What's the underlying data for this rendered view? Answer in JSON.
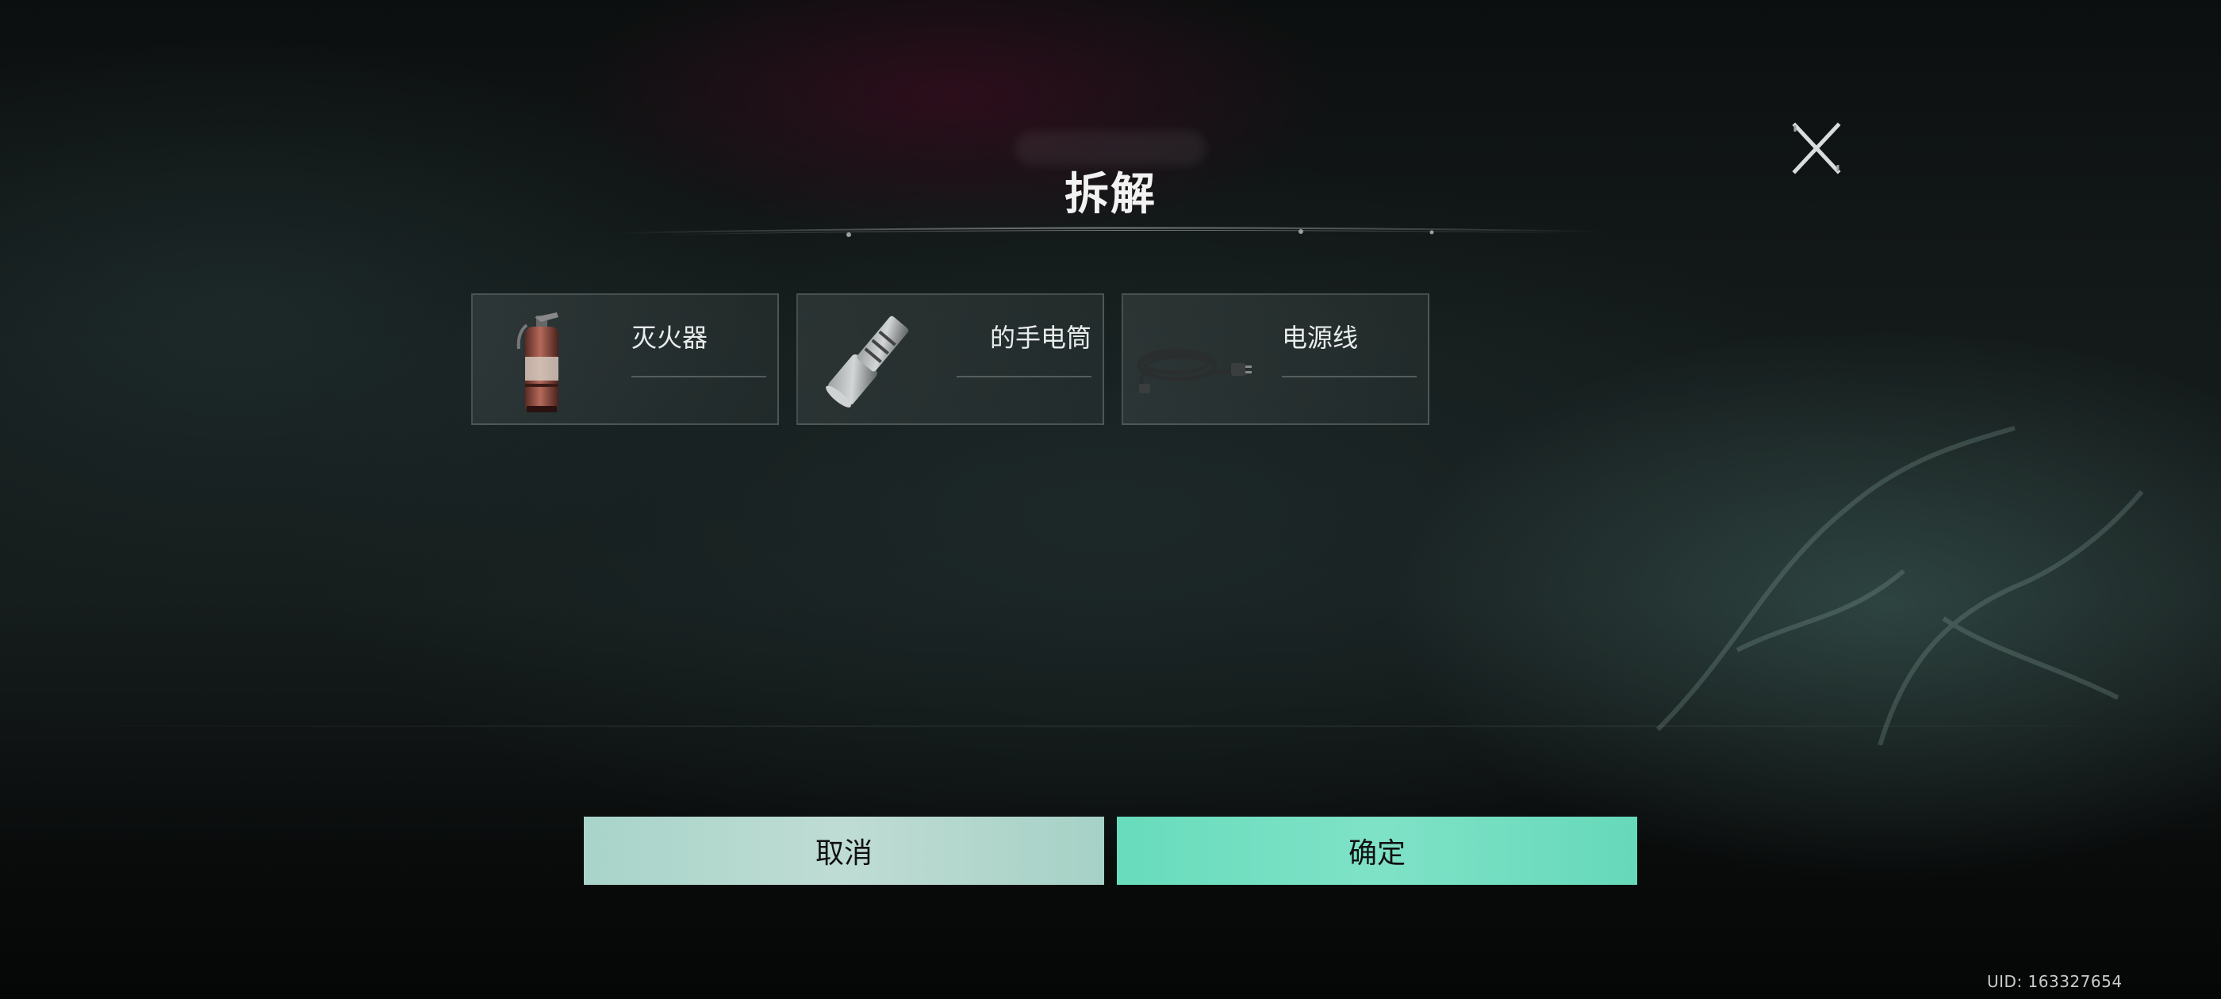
{
  "dialog": {
    "title": "拆解",
    "close_icon": "close-x-icon"
  },
  "items": [
    {
      "name": "灭火器",
      "icon": "fire-extinguisher-icon"
    },
    {
      "name": "的手电筒",
      "icon": "flashlight-icon"
    },
    {
      "name": "电源线",
      "icon": "power-cord-icon"
    }
  ],
  "buttons": {
    "cancel_label": "取消",
    "confirm_label": "确定"
  },
  "footer": {
    "uid": "UID: 163327654"
  },
  "colors": {
    "cancel_button": "#b6d9cf",
    "confirm_button": "#70dec0",
    "title_text": "#f2f2f2"
  }
}
